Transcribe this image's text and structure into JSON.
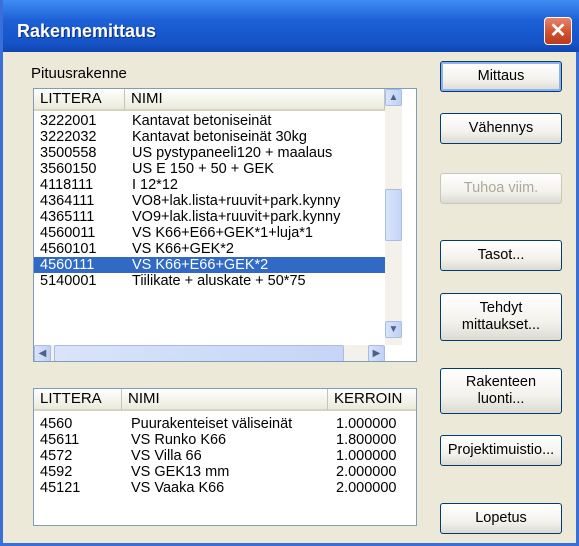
{
  "window": {
    "title": "Rakennemittaus",
    "close_glyph": "✕"
  },
  "section_label": "Pituusrakenne",
  "top_list": {
    "headers": [
      "LITTERA",
      "NIMI"
    ],
    "rows": [
      [
        "3222001",
        "Kantavat betoniseinät"
      ],
      [
        "3222032",
        "Kantavat betoniseinät 30kg"
      ],
      [
        "3500558",
        "US pystypaneeli120 + maalaus"
      ],
      [
        "3560150",
        "US E 150  + 50 + GEK"
      ],
      [
        "4118111",
        "I 12*12"
      ],
      [
        "4364111",
        "VO8+lak.lista+ruuvit+park.kynny"
      ],
      [
        "4365111",
        "VO9+lak.lista+ruuvit+park.kynny"
      ],
      [
        "4560011",
        "VS K66+E66+GEK*1+luja*1"
      ],
      [
        "4560101",
        "VS K66+GEK*2"
      ],
      [
        "4560111",
        "VS K66+E66+GEK*2"
      ],
      [
        "5140001",
        "Tiilikate + aluskate + 50*75"
      ]
    ],
    "selected_index": 9
  },
  "bottom_list": {
    "headers": [
      "LITTERA",
      "NIMI",
      "KERROIN"
    ],
    "rows": [
      [
        "4560",
        "Puurakenteiset väliseinät",
        "1.000000"
      ],
      [
        "45611",
        "VS Runko K66",
        "1.800000"
      ],
      [
        "4572",
        "VS Villa 66",
        "1.000000"
      ],
      [
        "4592",
        "VS GEK13 mm",
        "2.000000"
      ],
      [
        "45121",
        "VS Vaaka K66",
        "2.000000"
      ]
    ]
  },
  "buttons": {
    "mittaus": "Mittaus",
    "vahennys": "Vähennys",
    "tuhoa": "Tuhoa viim.",
    "tasot": "Tasot...",
    "tehdyt_1": "Tehdyt",
    "tehdyt_2": "mittaukset...",
    "rakenteen_1": "Rakenteen",
    "rakenteen_2": "luonti...",
    "projektimuistio": "Projektimuistio...",
    "lopetus": "Lopetus"
  },
  "icons": {
    "close": "close-icon",
    "scroll_up": "arrow-up-icon",
    "scroll_down": "arrow-down-icon",
    "scroll_left": "arrow-left-icon",
    "scroll_right": "arrow-right-icon",
    "scroll_up_glyph": "▲",
    "scroll_down_glyph": "▼",
    "scroll_left_glyph": "◀",
    "scroll_right_glyph": "▶"
  },
  "colors": {
    "titlebar": "#1d5fd6",
    "selection": "#316ac5",
    "window_bg": "#ece9d8"
  }
}
